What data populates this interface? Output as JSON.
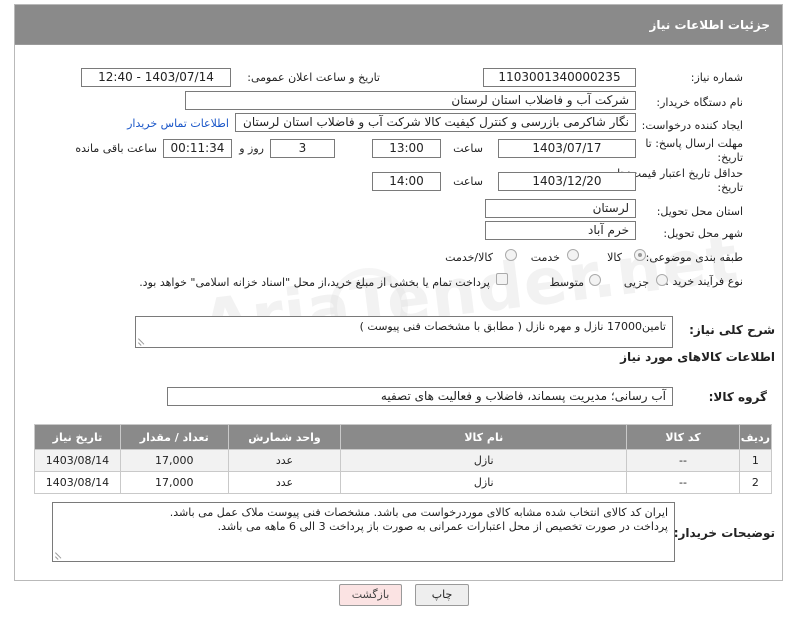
{
  "header": {
    "title": "جزئیات اطلاعات نیاز"
  },
  "fields": {
    "need_number_label": "شماره نیاز:",
    "need_number": "1103001340000235",
    "announce_label": "تاریخ و ساعت اعلان عمومی:",
    "announce_value": "1403/07/14 - 12:40",
    "buyer_org_label": "نام دستگاه خریدار:",
    "buyer_org": "شرکت آب و فاضلاب استان لرستان",
    "creator_label": "ایجاد کننده درخواست:",
    "creator": "نگار شاکرمی بازرسی و کنترل کیفیت کالا شرکت آب و فاضلاب استان لرستان",
    "buyer_contact_link": "اطلاعات تماس خریدار",
    "reply_deadline_label": "مهلت ارسال پاسخ: تا تاریخ:",
    "reply_date": "1403/07/17",
    "time_label": "ساعت",
    "reply_time": "13:00",
    "days_value": "3",
    "days_label": "روز و",
    "remaining_time": "00:11:34",
    "remaining_label": "ساعت باقی مانده",
    "price_validity_label": "حداقل تاریخ اعتبار قیمت: تا تاریخ:",
    "price_date": "1403/12/20",
    "price_time": "14:00",
    "province_label": "استان محل تحویل:",
    "province": "لرستان",
    "city_label": "شهر محل تحویل:",
    "city": "خرم آباد",
    "category_label": "طبقه بندی موضوعی:",
    "category_options": [
      "کالا",
      "خدمت",
      "کالا/خدمت"
    ],
    "process_label": "نوع فرآیند خرید :",
    "process_options": [
      "جزیی",
      "متوسط"
    ],
    "payment_note": "پرداخت تمام یا بخشی از مبلغ خرید،از محل \"اسناد خزانه اسلامی\" خواهد بود.",
    "summary_label": "شرح کلی نیاز:",
    "summary": "تامین17000 نازل و مهره نازل ( مطابق با مشخصات فنی پیوست )",
    "goods_info_title": "اطلاعات کالاهای مورد نیاز",
    "goods_group_label": "گروه کالا:",
    "goods_group": "آب رسانی؛ مدیریت پسماند، فاضلاب و فعالیت های تصفیه",
    "buyer_notes_label": "توضیحات خریدار:",
    "buyer_notes_line1": "ایران کد کالای انتخاب شده مشابه کالای موردرخواست می باشد. مشخصات فنی پیوست ملاک عمل می باشد.",
    "buyer_notes_line2": "پرداخت در صورت تخصیص از محل اعتبارات عمرانی  به صورت باز پرداخت  3 الی 6 ماهه می باشد."
  },
  "table": {
    "headers": [
      "ردیف",
      "کد کالا",
      "نام کالا",
      "واحد شمارش",
      "تعداد / مقدار",
      "تاریخ نیاز"
    ],
    "rows": [
      [
        "1",
        "--",
        "نازل",
        "عدد",
        "17,000",
        "1403/08/14"
      ],
      [
        "2",
        "--",
        "نازل",
        "عدد",
        "17,000",
        "1403/08/14"
      ]
    ]
  },
  "buttons": {
    "print": "چاپ",
    "back": "بازگشت"
  },
  "watermark": {
    "text": "AriaTender.net"
  },
  "colors": {
    "header_bg": "#8a8a8a",
    "link": "#1a56c8",
    "back_btn_bg": "#fbe3e3",
    "print_btn_bg": "#eeeeee"
  }
}
